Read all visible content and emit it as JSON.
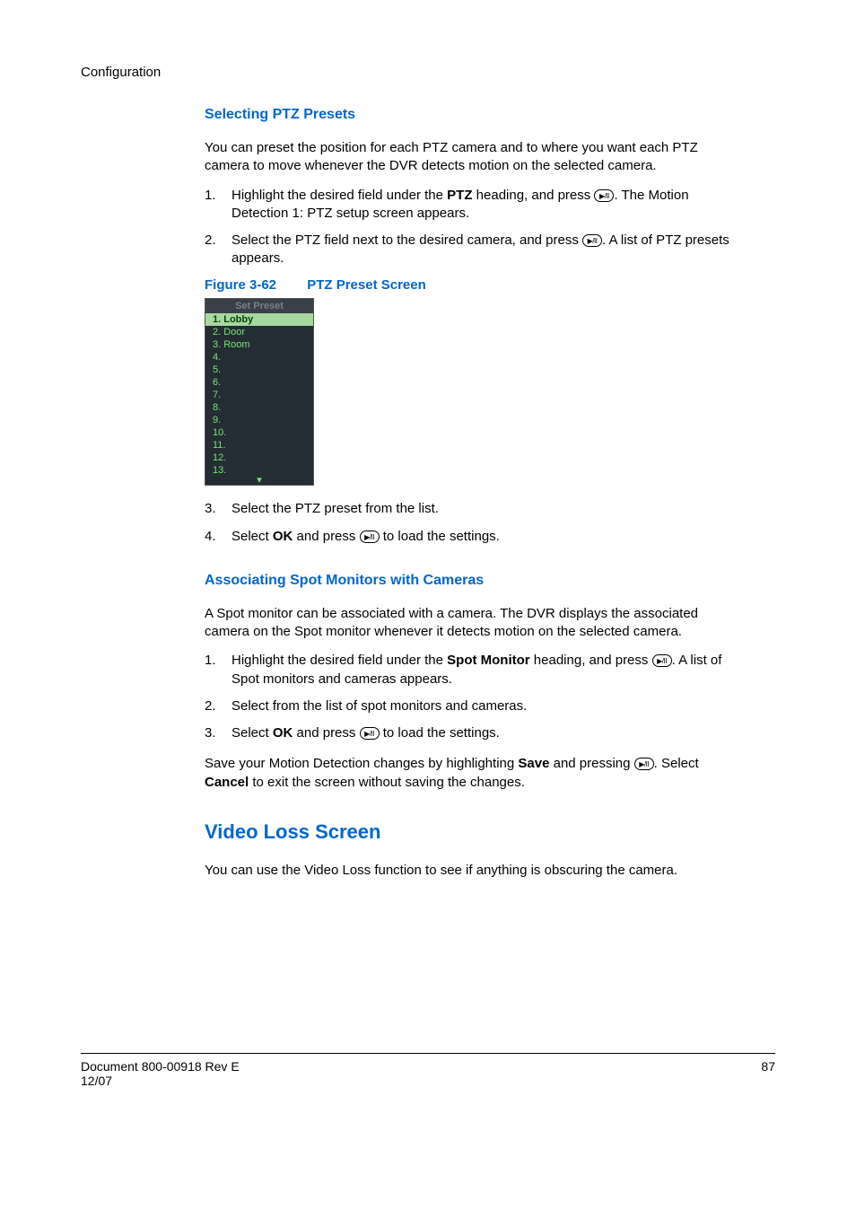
{
  "header": "Configuration",
  "section1_title": "Selecting PTZ Presets",
  "section1_para": "You can preset the position for each PTZ camera and to where you want each PTZ camera to move whenever the DVR detects motion on the selected camera.",
  "section1_step1_num": "1.",
  "section1_step1_a": "Highlight the desired field under the ",
  "section1_step1_ptz": "PTZ",
  "section1_step1_b": " heading, and press ",
  "section1_step1_c": ". The Motion Detection 1: PTZ setup screen appears.",
  "section1_step2_num": "2.",
  "section1_step2_a": "Select the PTZ field next to the desired camera, and press ",
  "section1_step2_b": ". A list of PTZ presets appears.",
  "fig_label": "Figure 3-62",
  "fig_title": "PTZ Preset Screen",
  "preset_header": "Set Preset",
  "preset_rows": [
    "1. Lobby",
    "2. Door",
    "3. Room",
    "4.",
    "5.",
    "6.",
    "7.",
    "8.",
    "9.",
    "10.",
    "11.",
    "12.",
    "13."
  ],
  "section1_step3_num": "3.",
  "section1_step3": "Select the PTZ preset from the list.",
  "section1_step4_num": "4.",
  "section1_step4_a": "Select ",
  "section1_step4_ok": "OK",
  "section1_step4_b": " and press ",
  "section1_step4_c": " to load the settings.",
  "section2_title": "Associating Spot Monitors with Cameras",
  "section2_para": "A Spot monitor can be associated with a camera. The DVR displays the associated camera on the Spot monitor whenever it detects motion on the selected camera.",
  "section2_step1_num": "1.",
  "section2_step1_a": "Highlight the desired field under the ",
  "section2_step1_spot": "Spot Monitor",
  "section2_step1_b": " heading, and press ",
  "section2_step1_c": ". A list of Spot monitors and cameras appears.",
  "section2_step2_num": "2.",
  "section2_step2": "Select from the list of spot monitors and cameras.",
  "section2_step3_num": "3.",
  "section2_step3_a": "Select ",
  "section2_step3_ok": "OK",
  "section2_step3_b": " and press ",
  "section2_step3_c": " to load the settings.",
  "section2_tail_a": "Save your Motion Detection changes by highlighting ",
  "section2_tail_save": "Save",
  "section2_tail_b": " and pressing ",
  "section2_tail_c": ". Select ",
  "section2_tail_cancel": "Cancel",
  "section2_tail_d": " to exit the screen without saving the changes.",
  "section3_h2": "Video Loss Screen",
  "section3_para": "You can use the Video Loss function to see if anything is obscuring the camera.",
  "footer_doc": "Document 800-00918 Rev E",
  "footer_date": "12/07",
  "footer_page": "87",
  "icon_glyph": "▶/II"
}
